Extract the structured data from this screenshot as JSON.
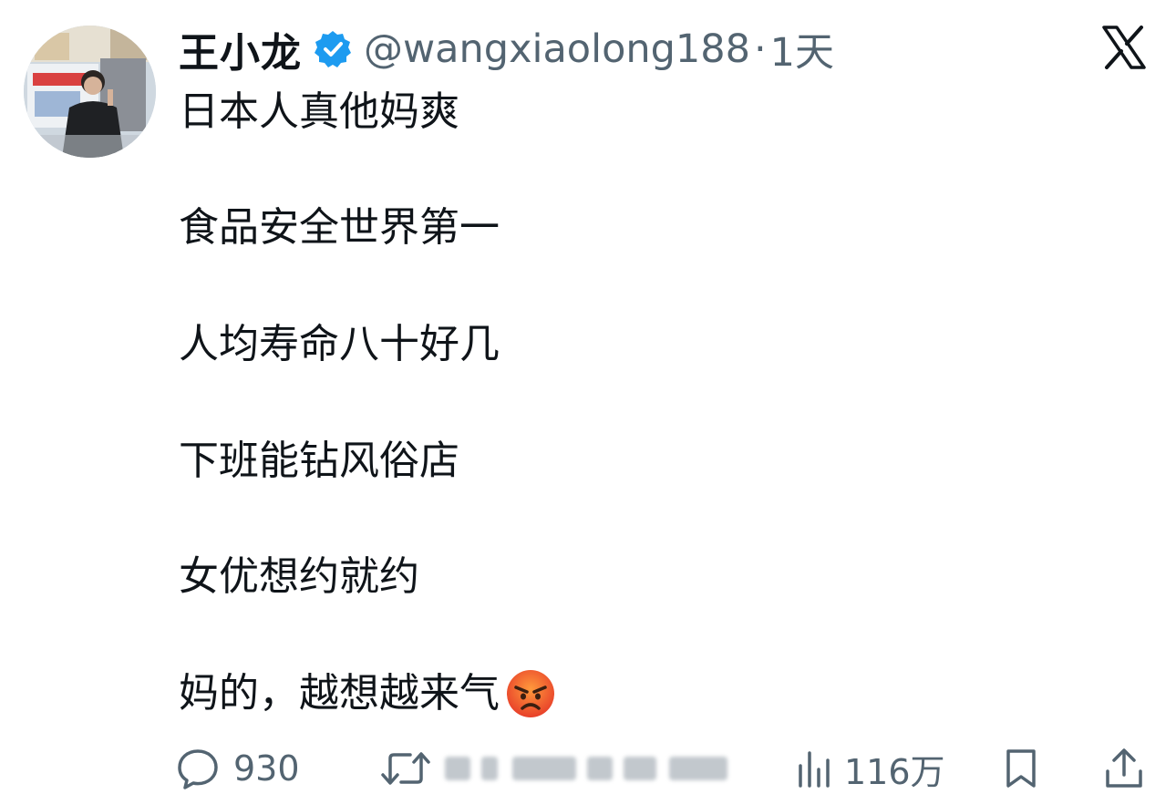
{
  "tweet": {
    "author": {
      "display_name": "王小龙",
      "handle": "@wangxiaolong188",
      "verified": true
    },
    "separator": "·",
    "time": "1天",
    "lines": [
      "日本人真他妈爽",
      "食品安全世界第一",
      "人均寿命八十好几",
      "下班能钻风俗店",
      "女优想约就约",
      "妈的，越想越来气"
    ],
    "trailing_emoji": "angry-face-emoji"
  },
  "actions": {
    "replies": "930",
    "views": "116万"
  },
  "icons": {
    "platform_logo": "x-logo-icon",
    "reply": "reply-bubble-icon",
    "retweet": "retweet-icon",
    "views": "views-chart-icon",
    "bookmark": "bookmark-icon",
    "share": "share-upload-icon"
  },
  "colors": {
    "text": "#0f1419",
    "secondary": "#536471",
    "verified": "#1d9bf0",
    "background": "#ffffff"
  }
}
